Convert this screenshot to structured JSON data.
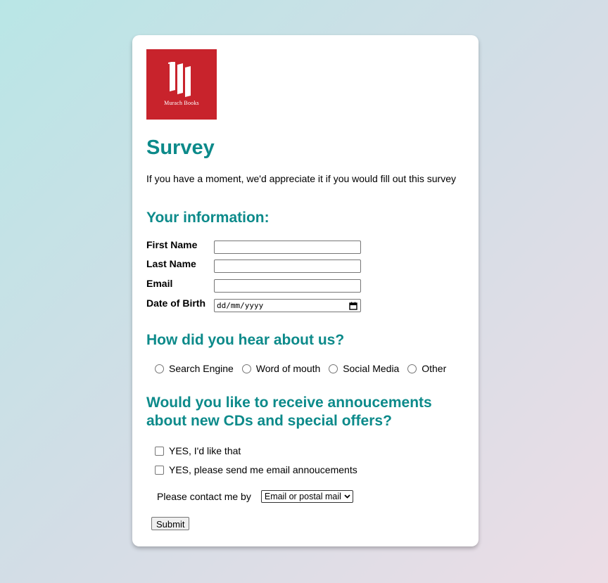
{
  "logo": {
    "text": "Murach Books",
    "brand_color": "#c8232c"
  },
  "title": "Survey",
  "intro": "If you have a moment, we'd appreciate it if you would fill out this survey",
  "info_section": {
    "heading": "Your information:",
    "fields": {
      "first_name": {
        "label": "First Name",
        "value": ""
      },
      "last_name": {
        "label": "Last Name",
        "value": ""
      },
      "email": {
        "label": "Email",
        "value": ""
      },
      "dob": {
        "label": "Date of Birth",
        "placeholder": "dd/mm/yyyy",
        "icon": "calendar-icon"
      }
    }
  },
  "hear_section": {
    "heading": "How did you hear about us?",
    "options": [
      "Search Engine",
      "Word of mouth",
      "Social Media",
      "Other"
    ]
  },
  "announce_section": {
    "heading": "Would you like to receive annoucements about new CDs and special offers?",
    "checkboxes": [
      "YES, I'd like that",
      "YES, please send me email annoucements"
    ],
    "contact_label": "Please contact me by",
    "contact_selected": "Email or postal mail"
  },
  "submit_label": "Submit",
  "colors": {
    "heading": "#0c8a8a",
    "card": "#ffffff"
  }
}
